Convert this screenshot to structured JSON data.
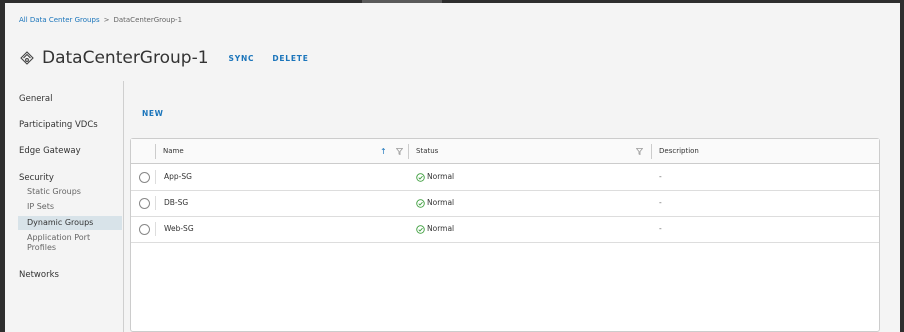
{
  "breadcrumb": {
    "parent": "All Data Center Groups",
    "separator": ">",
    "current": "DataCenterGroup-1"
  },
  "header": {
    "title": "DataCenterGroup-1",
    "sync_label": "SYNC",
    "delete_label": "DELETE",
    "icon": "datacenter-group-icon"
  },
  "sidebar": {
    "general": "General",
    "participating_vdcs": "Participating VDCs",
    "edge_gateway": "Edge Gateway",
    "security": "Security",
    "security_items": [
      "Static Groups",
      "IP Sets",
      "Dynamic Groups"
    ],
    "application_port_profiles_line1": "Application Port",
    "application_port_profiles_line2": "Profiles",
    "networks": "Networks",
    "active_item": "Dynamic Groups"
  },
  "toolbar": {
    "new_label": "NEW"
  },
  "grid": {
    "columns": {
      "name": "Name",
      "status": "Status",
      "description": "Description"
    },
    "sort": {
      "column": "Name",
      "direction": "ascending",
      "icon": "arrow-up"
    },
    "rows": [
      {
        "name": "App-SG",
        "status": "Normal",
        "description": "-"
      },
      {
        "name": "DB-SG",
        "status": "Normal",
        "description": "-"
      },
      {
        "name": "Web-SG",
        "status": "Normal",
        "description": "-"
      }
    ]
  },
  "colors": {
    "link": "#1b75bb",
    "active_bg": "#d8e3e9",
    "status_ok": "#3d9e3d",
    "frame": "#2e2e2e",
    "page_bg": "#f4f4f4"
  }
}
